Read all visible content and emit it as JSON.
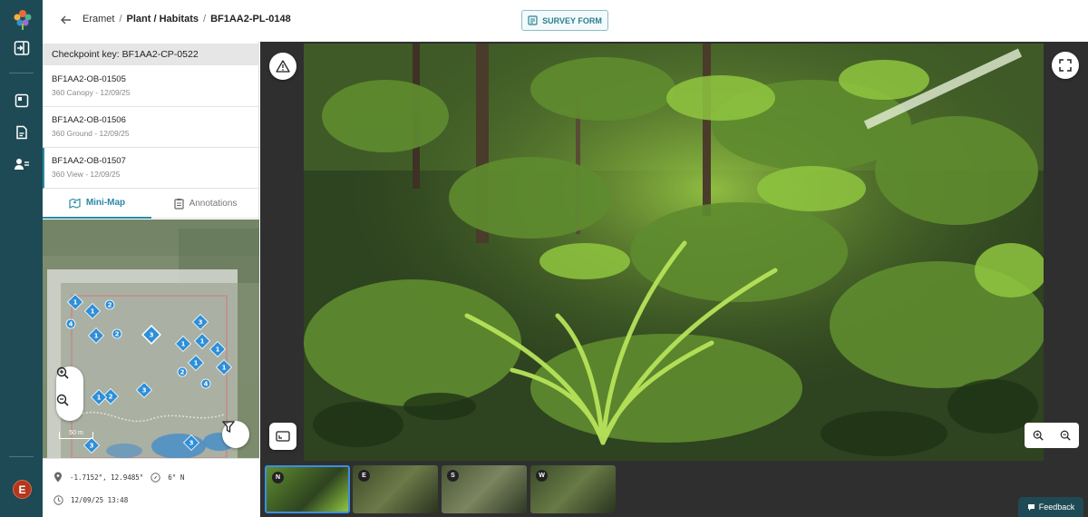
{
  "header": {
    "breadcrumb": [
      "Eramet",
      "Plant / Habitats",
      "BF1AA2-PL-0148"
    ],
    "survey_form_label": "SURVEY FORM"
  },
  "checkpoint": {
    "key_label": "Checkpoint key: BF1AA2-CP-0522",
    "items": [
      {
        "code": "BF1AA2-OB-01505",
        "type": "360 Canopy",
        "date": "12/09/25"
      },
      {
        "code": "BF1AA2-OB-01506",
        "type": "360 Ground",
        "date": "12/09/25"
      },
      {
        "code": "BF1AA2-OB-01507",
        "type": "360 View",
        "date": "12/09/25"
      }
    ],
    "date_separator": " - "
  },
  "tabs": {
    "minimap": "Mini-Map",
    "annotations": "Annotations"
  },
  "map": {
    "scale_label": "50 m",
    "markers": [
      "1",
      "2",
      "1",
      "4",
      "1",
      "2",
      "3",
      "3",
      "1",
      "1",
      "1",
      "2",
      "1",
      "4",
      "1",
      "2",
      "3",
      "1",
      "3",
      "3"
    ]
  },
  "location": {
    "coords": "-1.7152°, 12.9485°",
    "heading": "6° N",
    "timestamp": "12/09/25 13:48"
  },
  "viewer": {
    "thumbnails": [
      {
        "label": "N",
        "selected": true
      },
      {
        "label": "E",
        "selected": false
      },
      {
        "label": "S",
        "selected": false
      },
      {
        "label": "W",
        "selected": false
      }
    ]
  },
  "feedback_label": "Feedback",
  "user_initial": "E",
  "colors": {
    "rail": "#1e4a55",
    "accent": "#2a89a6",
    "marker": "#2f8fd8",
    "plot_border": "#e0607a",
    "avatar": "#b5361d"
  },
  "icons": [
    "back-arrow-icon",
    "form-icon",
    "alert-triangle-icon",
    "fullscreen-icon",
    "zoom-in-icon",
    "zoom-out-icon",
    "filter-icon",
    "pin-icon",
    "compass-icon",
    "clock-icon",
    "chat-icon"
  ]
}
